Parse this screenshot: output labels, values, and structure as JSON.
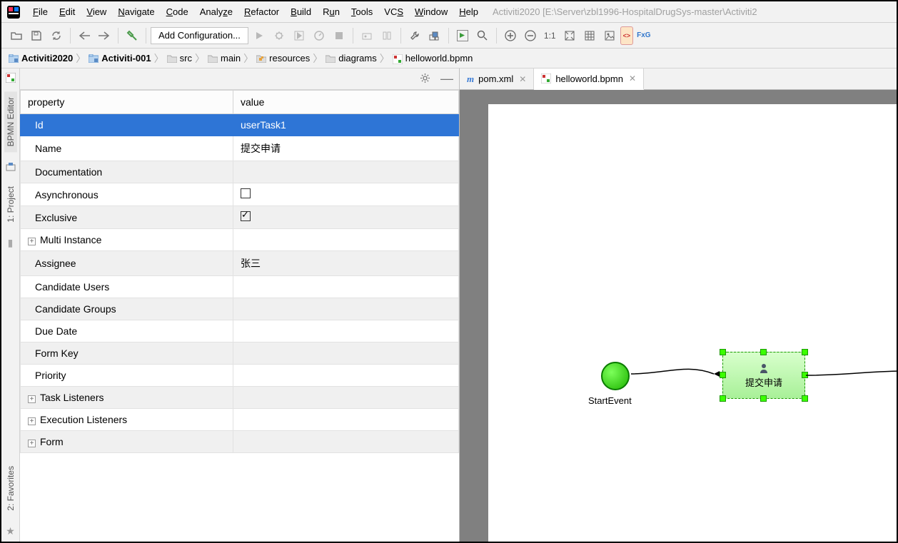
{
  "menu": {
    "items": [
      {
        "pre": "",
        "u": "F",
        "post": "ile"
      },
      {
        "pre": "",
        "u": "E",
        "post": "dit"
      },
      {
        "pre": "",
        "u": "V",
        "post": "iew"
      },
      {
        "pre": "",
        "u": "N",
        "post": "avigate"
      },
      {
        "pre": "",
        "u": "C",
        "post": "ode"
      },
      {
        "pre": "Analy",
        "u": "z",
        "post": "e"
      },
      {
        "pre": "",
        "u": "R",
        "post": "efactor"
      },
      {
        "pre": "",
        "u": "B",
        "post": "uild"
      },
      {
        "pre": "R",
        "u": "u",
        "post": "n"
      },
      {
        "pre": "",
        "u": "T",
        "post": "ools"
      },
      {
        "pre": "VC",
        "u": "S",
        "post": ""
      },
      {
        "pre": "",
        "u": "W",
        "post": "indow"
      },
      {
        "pre": "",
        "u": "H",
        "post": "elp"
      }
    ],
    "title_path": "Activiti2020 [E:\\Server\\zbl1996-HospitalDrugSys-master\\Activiti2"
  },
  "toolbar": {
    "config_label": "Add Configuration...",
    "ratio": "1:1",
    "fxg": "FxG"
  },
  "breadcrumb": {
    "items": [
      {
        "label": "Activiti2020",
        "bold": true,
        "icon": "module"
      },
      {
        "label": "Activiti-001",
        "bold": true,
        "icon": "module"
      },
      {
        "label": "src",
        "bold": false,
        "icon": "folder"
      },
      {
        "label": "main",
        "bold": false,
        "icon": "folder"
      },
      {
        "label": "resources",
        "bold": false,
        "icon": "resources"
      },
      {
        "label": "diagrams",
        "bold": false,
        "icon": "folder"
      },
      {
        "label": "helloworld.bpmn",
        "bold": false,
        "icon": "bpmn"
      }
    ]
  },
  "left_tabs": {
    "bpmn": "BPMN Editor",
    "project": "1: Project",
    "favorites": "2: Favorites"
  },
  "props": {
    "header_property": "property",
    "header_value": "value",
    "rows": [
      {
        "key": "Id",
        "value": "userTask1",
        "type": "text",
        "selected": true
      },
      {
        "key": "Name",
        "value": "提交申请",
        "type": "text"
      },
      {
        "key": "Documentation",
        "value": "",
        "type": "text"
      },
      {
        "key": "Asynchronous",
        "value": false,
        "type": "checkbox"
      },
      {
        "key": "Exclusive",
        "value": true,
        "type": "checkbox"
      },
      {
        "key": "Multi Instance",
        "value": "",
        "type": "group"
      },
      {
        "key": "Assignee",
        "value": "张三",
        "type": "text"
      },
      {
        "key": "Candidate Users",
        "value": "",
        "type": "text"
      },
      {
        "key": "Candidate Groups",
        "value": "",
        "type": "text"
      },
      {
        "key": "Due Date",
        "value": "",
        "type": "text"
      },
      {
        "key": "Form Key",
        "value": "",
        "type": "text"
      },
      {
        "key": "Priority",
        "value": "",
        "type": "text"
      },
      {
        "key": "Task Listeners",
        "value": "",
        "type": "group"
      },
      {
        "key": "Execution Listeners",
        "value": "",
        "type": "group"
      },
      {
        "key": "Form",
        "value": "",
        "type": "group"
      }
    ]
  },
  "editor": {
    "tabs": [
      {
        "label": "pom.xml",
        "icon": "maven",
        "active": false
      },
      {
        "label": "helloworld.bpmn",
        "icon": "bpmn",
        "active": true
      }
    ]
  },
  "diagram": {
    "start_label": "StartEvent",
    "task_label": "提交申请"
  }
}
